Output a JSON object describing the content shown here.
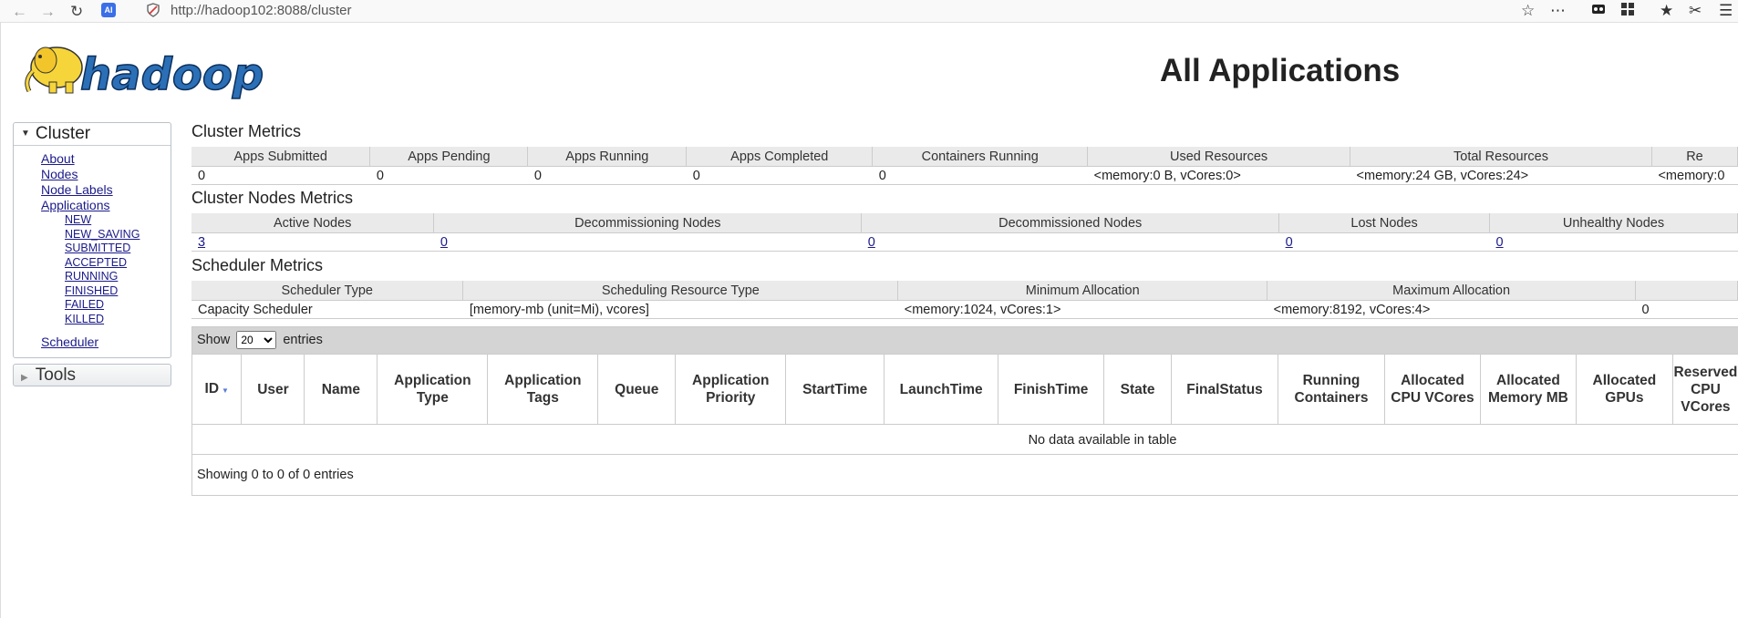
{
  "browser": {
    "url": "http://hadoop102:8088/cluster",
    "ai_badge": "AI",
    "icons": [
      "back-icon",
      "forward-icon",
      "reload-icon",
      "site-security-icon",
      "bookmark-star-icon",
      "more-icon",
      "extensions-icon",
      "grid-icon",
      "favorites-icon",
      "screenshot-icon",
      "menu-icon"
    ]
  },
  "logo": {
    "text": "hadoop",
    "brand_color": "#2b6fb6",
    "elephant_color": "#f6d53a"
  },
  "page_title": "All Applications",
  "sidebar": {
    "cluster_label": "Cluster",
    "items": [
      "About",
      "Nodes",
      "Node Labels",
      "Applications"
    ],
    "app_states": [
      "NEW",
      "NEW_SAVING",
      "SUBMITTED",
      "ACCEPTED",
      "RUNNING",
      "FINISHED",
      "FAILED",
      "KILLED"
    ],
    "scheduler_label": "Scheduler",
    "tools_label": "Tools"
  },
  "cluster_metrics": {
    "title": "Cluster Metrics",
    "headers": [
      "Apps Submitted",
      "Apps Pending",
      "Apps Running",
      "Apps Completed",
      "Containers Running",
      "Used Resources",
      "Total Resources",
      "Re"
    ],
    "values": [
      "0",
      "0",
      "0",
      "0",
      "0",
      "<memory:0 B, vCores:0>",
      "<memory:24 GB, vCores:24>",
      "<memory:0"
    ]
  },
  "nodes_metrics": {
    "title": "Cluster Nodes Metrics",
    "headers": [
      "Active Nodes",
      "Decommissioning Nodes",
      "Decommissioned Nodes",
      "Lost Nodes",
      "Unhealthy Nodes"
    ],
    "values": [
      "3",
      "0",
      "0",
      "0",
      "0"
    ]
  },
  "scheduler_metrics": {
    "title": "Scheduler Metrics",
    "headers": [
      "Scheduler Type",
      "Scheduling Resource Type",
      "Minimum Allocation",
      "Maximum Allocation",
      ""
    ],
    "values": [
      "Capacity Scheduler",
      "[memory-mb (unit=Mi), vcores]",
      "<memory:1024, vCores:1>",
      "<memory:8192, vCores:4>",
      "0"
    ]
  },
  "apps_table": {
    "show_label": "Show",
    "page_size": "20",
    "entries_label": "entries",
    "columns": [
      "ID",
      "User",
      "Name",
      "Application Type",
      "Application Tags",
      "Queue",
      "Application Priority",
      "StartTime",
      "LaunchTime",
      "FinishTime",
      "State",
      "FinalStatus",
      "Running Containers",
      "Allocated CPU VCores",
      "Allocated Memory MB",
      "Allocated GPUs",
      "Reserved CPU VCores"
    ],
    "empty_message": "No data available in table",
    "info": "Showing 0 to 0 of 0 entries"
  }
}
